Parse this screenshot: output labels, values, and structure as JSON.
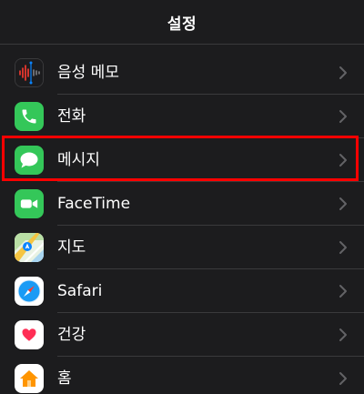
{
  "nav": {
    "title": "설정"
  },
  "rows": [
    {
      "label": "음성 메모",
      "icon": "voice-memos-icon",
      "icon_bg": "#1c1c1e"
    },
    {
      "label": "전화",
      "icon": "phone-icon",
      "icon_bg": "#34c759"
    },
    {
      "label": "메시지",
      "icon": "messages-icon",
      "icon_bg": "#34c759"
    },
    {
      "label": "FaceTime",
      "icon": "facetime-icon",
      "icon_bg": "#34c759"
    },
    {
      "label": "지도",
      "icon": "maps-icon",
      "icon_bg": "#ffffff"
    },
    {
      "label": "Safari",
      "icon": "safari-icon",
      "icon_bg": "#ffffff"
    },
    {
      "label": "건강",
      "icon": "health-icon",
      "icon_bg": "#ffffff"
    },
    {
      "label": "홈",
      "icon": "home-icon",
      "icon_bg": "#ffffff"
    }
  ],
  "colors": {
    "highlight": "#ff0000",
    "accent_green": "#34c759",
    "background": "#1c1c1e",
    "separator": "#3a3a3c"
  }
}
